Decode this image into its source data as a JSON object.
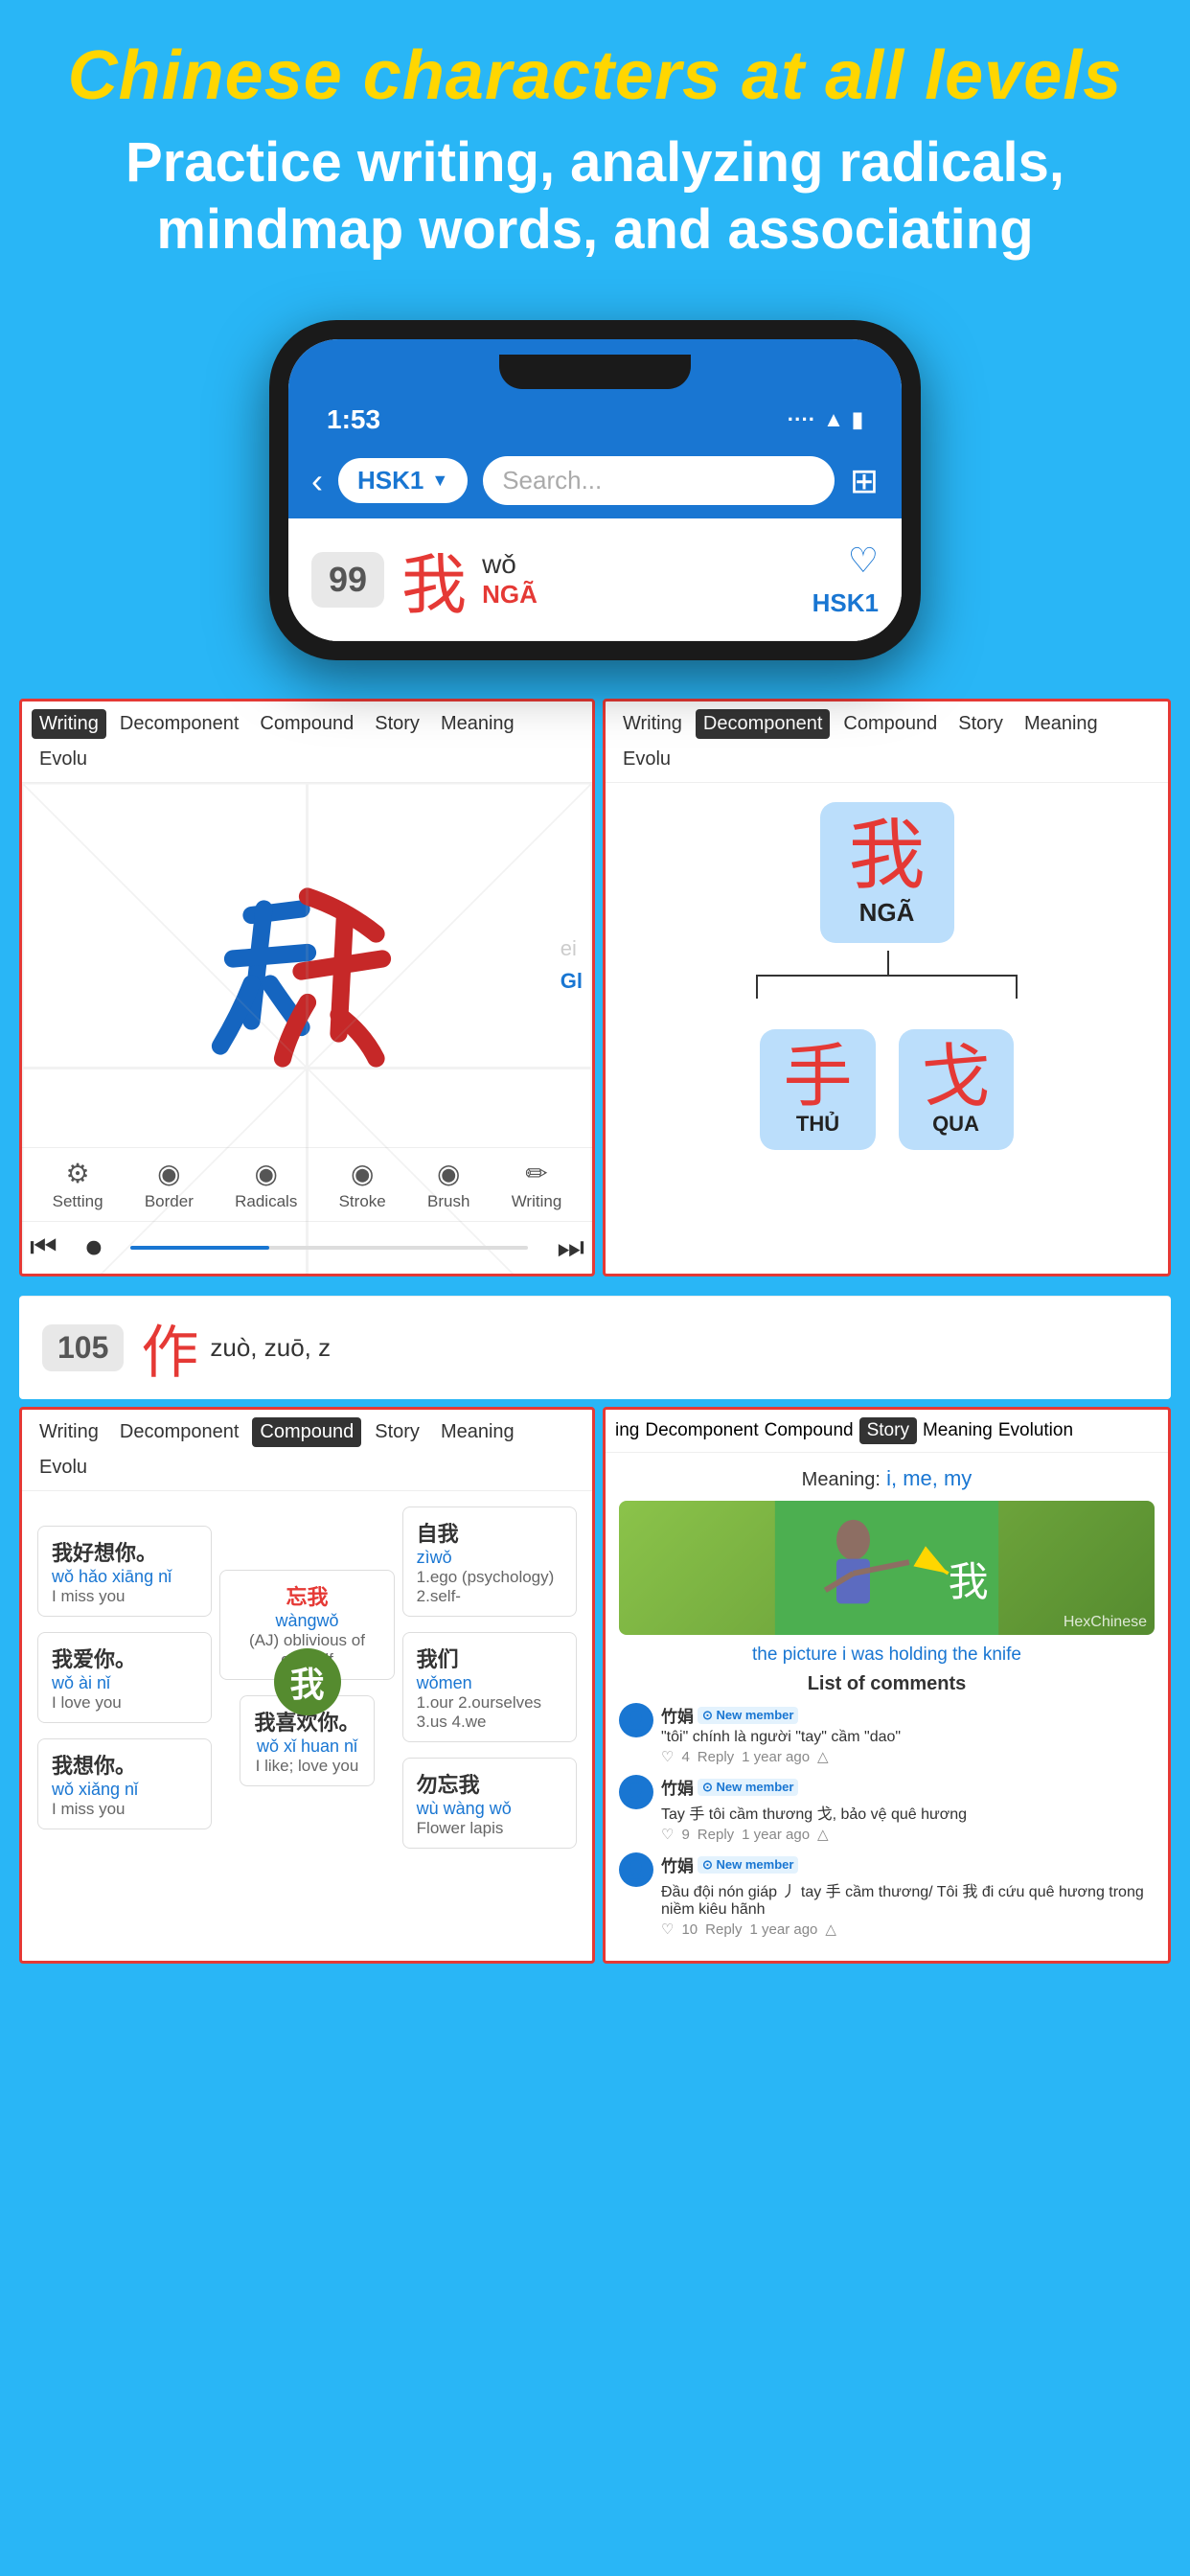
{
  "header": {
    "title": "Chinese characters at all levels",
    "subtitle": "Practice writing, analyzing radicals, mindmap words, and associating"
  },
  "phone": {
    "time": "1:53",
    "signal_bars": "····",
    "wifi": "WiFi",
    "battery": "Battery"
  },
  "app": {
    "back_label": "‹",
    "hsk_level": "HSK1",
    "search_placeholder": "Search...",
    "grid_icon": "⊞"
  },
  "character_card": {
    "number": "99",
    "chinese": "我",
    "pinyin": "wǒ",
    "vietnamese": "NGÃ",
    "level": "HSK1"
  },
  "writing_panel": {
    "tabs": [
      "Writing",
      "Decomponent",
      "Compound",
      "Story",
      "Meaning",
      "Evolu"
    ],
    "active_tab": "Writing",
    "stroke_labels": [
      "ei",
      "Gl"
    ],
    "controls": [
      {
        "icon": "⚙",
        "label": "Setting"
      },
      {
        "icon": "◉",
        "label": "Border"
      },
      {
        "icon": "◉",
        "label": "Radicals"
      },
      {
        "icon": "◉",
        "label": "Stroke"
      },
      {
        "icon": "◉",
        "label": "Brush"
      },
      {
        "icon": "✏",
        "label": "Writing"
      }
    ]
  },
  "decomp_panel": {
    "tabs": [
      "Writing",
      "Decomponent",
      "Compound",
      "Story",
      "Meaning",
      "Evolu"
    ],
    "active_tab": "Decomponent",
    "main_char": "我",
    "main_label": "NGÃ",
    "sub_chars": [
      {
        "char": "手",
        "label": "THỦ"
      },
      {
        "char": "戈",
        "label": "QUA"
      }
    ]
  },
  "char_number_row": {
    "number": "105",
    "chinese": "作",
    "pinyin": "zuò, zuō, z"
  },
  "compound_panel": {
    "tabs": [
      "Writing",
      "Decomponent",
      "Compound",
      "Story",
      "Meaning",
      "Evolu"
    ],
    "active_tab": "Compound",
    "center_char": "我",
    "words": [
      {
        "chinese": "我好想你。",
        "pinyin": "wǒ hǎo xiāng nǐ",
        "meaning": "I miss you"
      },
      {
        "chinese": "忘我",
        "pinyin": "wàngwǒ",
        "meaning": "(AJ) oblivious of oneself"
      },
      {
        "chinese": "自我",
        "pinyin": "zìwǒ",
        "meaning": "1.ego (psychology) 2.self-"
      },
      {
        "chinese": "我爱你。",
        "pinyin": "wǒ ài nǐ",
        "meaning": "I love you"
      },
      {
        "chinese": "我们",
        "pinyin": "wǒmen",
        "meaning": "1.our 2.ourselves 3.us 4.we"
      },
      {
        "chinese": "我想你。",
        "pinyin": "wǒ xiǎng nǐ",
        "meaning": "I miss you"
      },
      {
        "chinese": "我喜欢你。",
        "pinyin": "wǒ xǐ huan nǐ",
        "meaning": "I like; love you"
      },
      {
        "chinese": "勿忘我",
        "pinyin": "wù wàng wǒ",
        "meaning": "Flower lapis"
      }
    ]
  },
  "story_panel": {
    "tabs": [
      "ing",
      "Decomponent",
      "Compound",
      "Story",
      "Meaning",
      "Evolution"
    ],
    "active_tab": "Story",
    "meaning": "i, me, my",
    "picture_caption": "the picture i was holding the knife",
    "image_brand": "HexChinese",
    "comments_title": "List of comments",
    "comments": [
      {
        "author": "竹娟",
        "badge": "New member",
        "text": "\"tôi\" chính là người \"tay\" cầm \"dao\"",
        "likes": 4,
        "reply": "Reply",
        "time": "1 year ago"
      },
      {
        "author": "竹娟",
        "badge": "New member",
        "text": "Tay 手 tôi cầm thương 戈, bảo vệ quê hương",
        "likes": 9,
        "reply": "Reply",
        "time": "1 year ago"
      },
      {
        "author": "竹娟",
        "badge": "New member",
        "text": "Đầu đội nón giáp 丿 tay 手 cầm thương/ Tôi 我 đi cứu quê hương trong niềm kiêu hãnh",
        "likes": 10,
        "reply": "Reply",
        "time": "1 year ago"
      }
    ]
  }
}
